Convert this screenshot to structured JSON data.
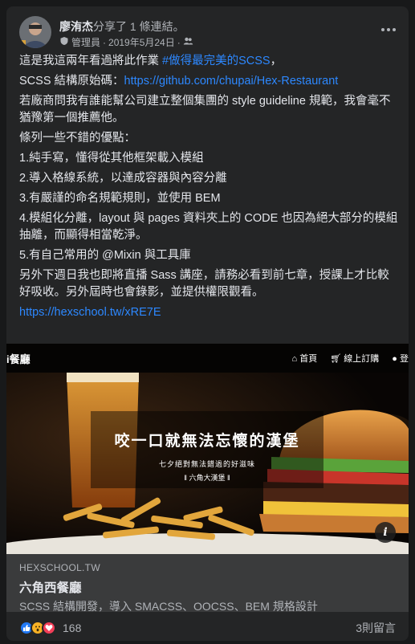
{
  "post": {
    "author": "廖洧杰",
    "action": "分享了 1 條連結。",
    "role": "管理員",
    "separator": "·",
    "date": "2019年5月24日",
    "separator2": "·"
  },
  "body": {
    "p1_prefix": "這是我這兩年看過將此作業 ",
    "p1_hashtag": "#做得最完美的SCSS",
    "p1_suffix": "，",
    "p2_prefix": "SCSS 結構原始碼：",
    "p2_link": "https://github.com/chupai/Hex-Restaurant",
    "p3": "若廠商問我有誰能幫公司建立整個集團的 style guideline 規範，我會毫不猶豫第一個推薦他。",
    "p4": "條列一些不錯的優點：",
    "p5": "1.純手寫，懂得從其他框架載入模組",
    "p6": "2.導入格線系統，以達成容器與內容分離",
    "p7": "3.有嚴謹的命名規範規則，並使用 BEM",
    "p8": "4.模組化分離，layout 與 pages 資料夾上的 CODE 也因為絕大部分的模組抽離，而顯得相當乾淨。",
    "p9": "5.有自己常用的 @Mixin 與工具庫",
    "p10": "另外下週日我也即將直播 Sass 講座，請務必看到前七章，授課上才比較好吸收。另外屆時也會錄影，並提供權限觀看。",
    "p11_link": "https://hexschool.tw/xRE7E"
  },
  "preview": {
    "brand": "i餐廳",
    "nav": [
      "首頁",
      "線上訂購",
      "登"
    ],
    "hero_title": "咬一口就無法忘懷的漢堡",
    "hero_sub": "七夕絕對無法錯過的好滋味",
    "hero_tag": "六角大漢堡"
  },
  "link_meta": {
    "domain": "HEXSCHOOL.TW",
    "title": "六角西餐廳",
    "description": "SCSS 結構開發，導入 SMACSS、OOCSS、BEM 規格設計"
  },
  "footer": {
    "reaction_count": "168",
    "comments": "3則留言"
  },
  "colors": {
    "background": "#18191a",
    "card": "#242526",
    "link": "#2d88ff",
    "like": "#2078f4",
    "wow": "#f7b125",
    "love": "#f33e58"
  },
  "icons": {
    "admin": "shield-icon",
    "privacy": "group-icon",
    "more": "more-options-icon",
    "info": "info-icon"
  }
}
